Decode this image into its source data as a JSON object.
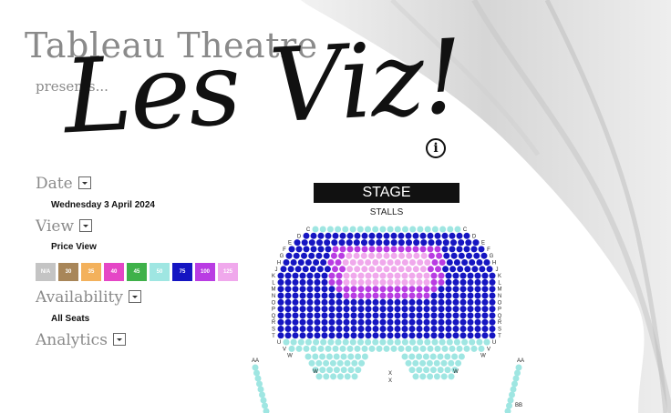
{
  "header": {
    "brand": "Tableau Theatre",
    "presents": "presents...",
    "title": "Les Viz!",
    "info_icon": "info-icon"
  },
  "controls": {
    "date": {
      "label": "Date",
      "value": "Wednesday 3 April 2024"
    },
    "view": {
      "label": "View",
      "value": "Price View"
    },
    "availability": {
      "label": "Availability",
      "value": "All Seats"
    },
    "analytics": {
      "label": "Analytics"
    }
  },
  "legend": [
    {
      "label": "N/A",
      "color": "#c4c4c4"
    },
    {
      "label": "30",
      "color": "#a88659"
    },
    {
      "label": "35",
      "color": "#f3b15c"
    },
    {
      "label": "40",
      "color": "#e546c6"
    },
    {
      "label": "45",
      "color": "#3fb14a"
    },
    {
      "label": "50",
      "color": "#9fe6e2"
    },
    {
      "label": "75",
      "color": "#1515c2"
    },
    {
      "label": "100",
      "color": "#b93ce3"
    },
    {
      "label": "125",
      "color": "#f0a8ec"
    }
  ],
  "seatmap": {
    "stage_label": "STAGE",
    "section_label": "STALLS",
    "row_labels_left": [
      "C",
      "D",
      "E",
      "F",
      "G",
      "H",
      "J",
      "K",
      "L",
      "M",
      "N",
      "O",
      "P",
      "Q",
      "R",
      "S",
      "T",
      "U",
      "V",
      "W",
      "AA"
    ],
    "row_labels_right": [
      "C",
      "D",
      "E",
      "F",
      "G",
      "H",
      "J",
      "K",
      "L",
      "M",
      "N",
      "O",
      "P",
      "Q",
      "R",
      "S",
      "T",
      "U",
      "V",
      "W",
      "AA",
      "BB"
    ],
    "row_labels_center": [
      "W",
      "X",
      "W",
      "X"
    ]
  }
}
